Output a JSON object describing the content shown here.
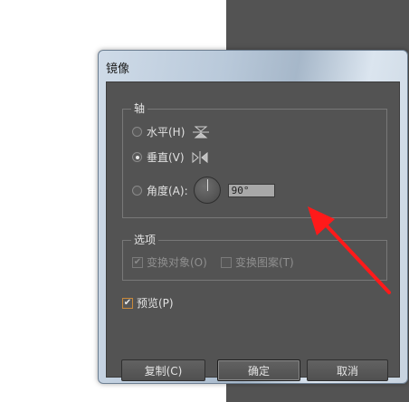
{
  "dialog": {
    "title": "镜像",
    "axis_group": {
      "title": "轴",
      "options": [
        {
          "label": "水平(H)",
          "icon": "horizontal-axis-icon",
          "selected": false
        },
        {
          "label": "垂直(V)",
          "icon": "vertical-axis-icon",
          "selected": true
        }
      ],
      "angle_label": "角度(A):",
      "angle_value": "90°"
    },
    "options_group": {
      "title": "选项",
      "transform_objects": "变换对象(O)",
      "transform_patterns": "变换图案(T)"
    },
    "preview_label": "预览(P)",
    "buttons": {
      "copy": "复制(C)",
      "ok": "确定",
      "cancel": "取消"
    }
  },
  "colors": {
    "panel_bg": "#535353",
    "annotation_arrow": "#ff1a1a",
    "focus_checkbox": "#c9893b"
  }
}
